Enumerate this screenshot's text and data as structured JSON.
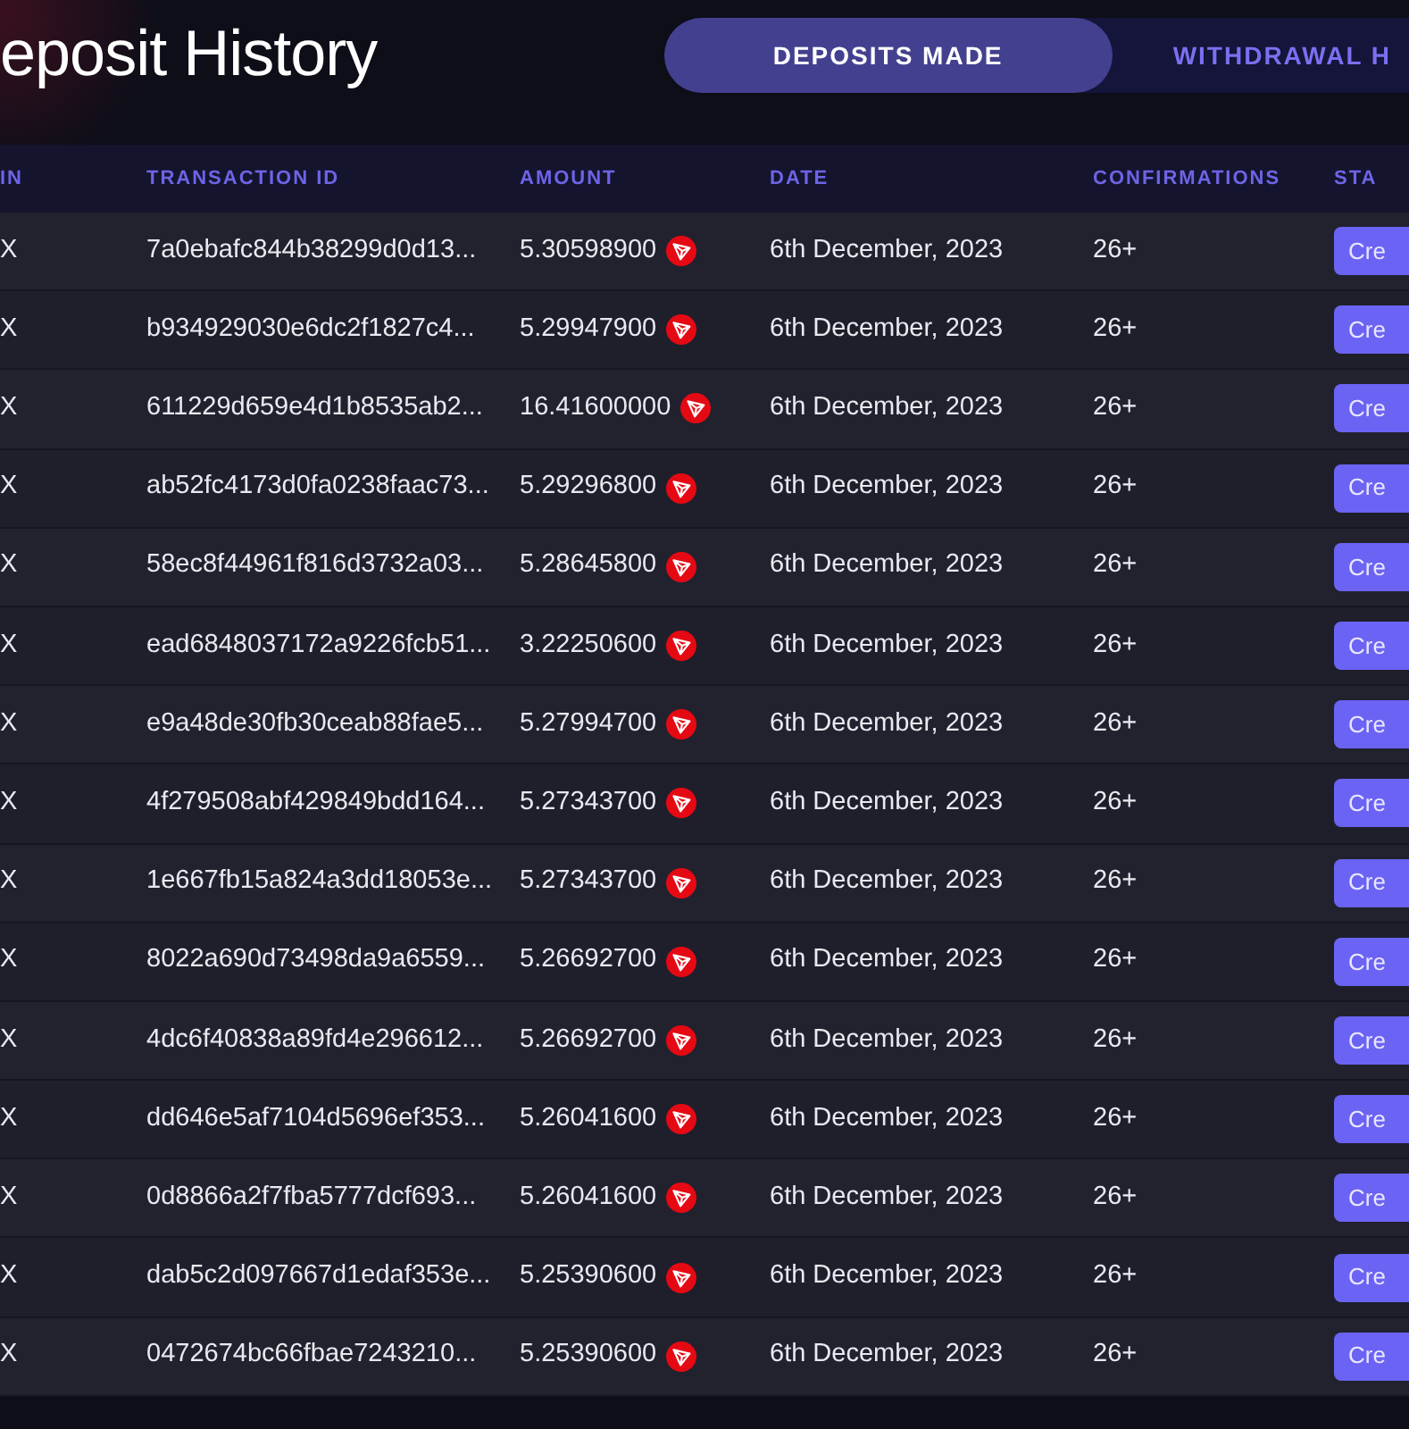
{
  "page": {
    "title": "eposit History"
  },
  "tabs": [
    {
      "label": "DEPOSITS MADE",
      "selected": true
    },
    {
      "label": "WITHDRAWAL H",
      "selected": false
    }
  ],
  "table": {
    "columns": [
      "IN",
      "TRANSACTION ID",
      "AMOUNT",
      "DATE",
      "CONFIRMATIONS",
      "STA"
    ],
    "rows": [
      {
        "coin": "X",
        "transaction_id": "7a0ebafc844b38299d0d13...",
        "amount": "5.30598900",
        "date": "6th December, 2023",
        "confirmations": "26+",
        "status": "Cre"
      },
      {
        "coin": "X",
        "transaction_id": "b934929030e6dc2f1827c4...",
        "amount": "5.29947900",
        "date": "6th December, 2023",
        "confirmations": "26+",
        "status": "Cre"
      },
      {
        "coin": "X",
        "transaction_id": "611229d659e4d1b8535ab2...",
        "amount": "16.41600000",
        "date": "6th December, 2023",
        "confirmations": "26+",
        "status": "Cre"
      },
      {
        "coin": "X",
        "transaction_id": "ab52fc4173d0fa0238faac73...",
        "amount": "5.29296800",
        "date": "6th December, 2023",
        "confirmations": "26+",
        "status": "Cre"
      },
      {
        "coin": "X",
        "transaction_id": "58ec8f44961f816d3732a03...",
        "amount": "5.28645800",
        "date": "6th December, 2023",
        "confirmations": "26+",
        "status": "Cre"
      },
      {
        "coin": "X",
        "transaction_id": "ead6848037172a9226fcb51...",
        "amount": "3.22250600",
        "date": "6th December, 2023",
        "confirmations": "26+",
        "status": "Cre"
      },
      {
        "coin": "X",
        "transaction_id": "e9a48de30fb30ceab88fae5...",
        "amount": "5.27994700",
        "date": "6th December, 2023",
        "confirmations": "26+",
        "status": "Cre"
      },
      {
        "coin": "X",
        "transaction_id": "4f279508abf429849bdd164...",
        "amount": "5.27343700",
        "date": "6th December, 2023",
        "confirmations": "26+",
        "status": "Cre"
      },
      {
        "coin": "X",
        "transaction_id": "1e667fb15a824a3dd18053e...",
        "amount": "5.27343700",
        "date": "6th December, 2023",
        "confirmations": "26+",
        "status": "Cre"
      },
      {
        "coin": "X",
        "transaction_id": "8022a690d73498da9a6559...",
        "amount": "5.26692700",
        "date": "6th December, 2023",
        "confirmations": "26+",
        "status": "Cre"
      },
      {
        "coin": "X",
        "transaction_id": "4dc6f40838a89fd4e296612...",
        "amount": "5.26692700",
        "date": "6th December, 2023",
        "confirmations": "26+",
        "status": "Cre"
      },
      {
        "coin": "X",
        "transaction_id": "dd646e5af7104d5696ef353...",
        "amount": "5.26041600",
        "date": "6th December, 2023",
        "confirmations": "26+",
        "status": "Cre"
      },
      {
        "coin": "X",
        "transaction_id": "0d8866a2f7fba5777dcf693...",
        "amount": "5.26041600",
        "date": "6th December, 2023",
        "confirmations": "26+",
        "status": "Cre"
      },
      {
        "coin": "X",
        "transaction_id": "dab5c2d097667d1edaf353e...",
        "amount": "5.25390600",
        "date": "6th December, 2023",
        "confirmations": "26+",
        "status": "Cre"
      },
      {
        "coin": "X",
        "transaction_id": "0472674bc66fbae7243210...",
        "amount": "5.25390600",
        "date": "6th December, 2023",
        "confirmations": "26+",
        "status": "Cre"
      }
    ]
  }
}
